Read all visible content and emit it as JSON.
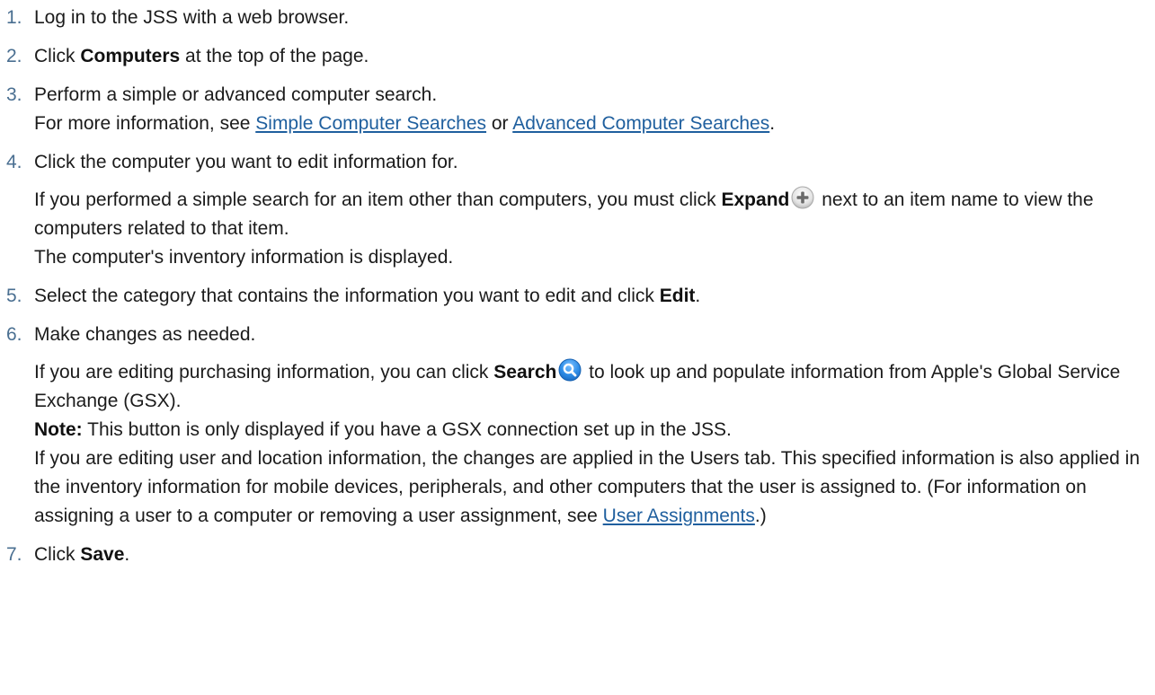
{
  "steps": [
    {
      "num": "1.",
      "text": "Log in to the JSS with a web browser."
    },
    {
      "num": "2.",
      "pre": "Click ",
      "bold": "Computers",
      "post": " at the top of the page."
    },
    {
      "num": "3.",
      "line1": "Perform a simple or advanced computer search.",
      "line2_pre": "For more information, see ",
      "link1": "Simple Computer Searches",
      "line2_mid": " or ",
      "link2": "Advanced Computer Searches",
      "line2_post": "."
    },
    {
      "num": "4.",
      "line1": "Click the computer you want to edit information for.",
      "p_pre": "If you performed a simple search for an item other than computers, you must click ",
      "p_bold": "Expand",
      "p_post": " next to an item name to view the computers related to that item.",
      "line_last": "The computer's inventory information is displayed."
    },
    {
      "num": "5.",
      "pre": "Select the category that contains the information you want to edit and click ",
      "bold": "Edit",
      "post": "."
    },
    {
      "num": "6.",
      "line1": "Make changes as needed.",
      "p_pre": "If you are editing purchasing information, you can click ",
      "p_bold": "Search",
      "p_post": " to look up and populate information from Apple's Global Service Exchange (GSX).",
      "note_label": "Note:",
      "note_text": " This button is only displayed if you have a GSX connection set up in the JSS.",
      "user_pre": "If you are editing user and location information, the changes are applied in the Users tab. This specified information is also applied in the inventory information for mobile devices, peripherals, and other computers that the user is assigned to. (For information on assigning a user to a computer or removing a user assignment, see ",
      "user_link": "User Assignments",
      "user_post": ".)"
    },
    {
      "num": "7.",
      "pre": "Click ",
      "bold": "Save",
      "post": "."
    }
  ],
  "icons": {
    "expand": "plus-circle-icon",
    "search": "magnifier-circle-icon"
  },
  "colors": {
    "text": "#1b1b1b",
    "number": "#4a6f91",
    "link": "#1f5f9e",
    "search_icon": "#2f8ee8"
  }
}
